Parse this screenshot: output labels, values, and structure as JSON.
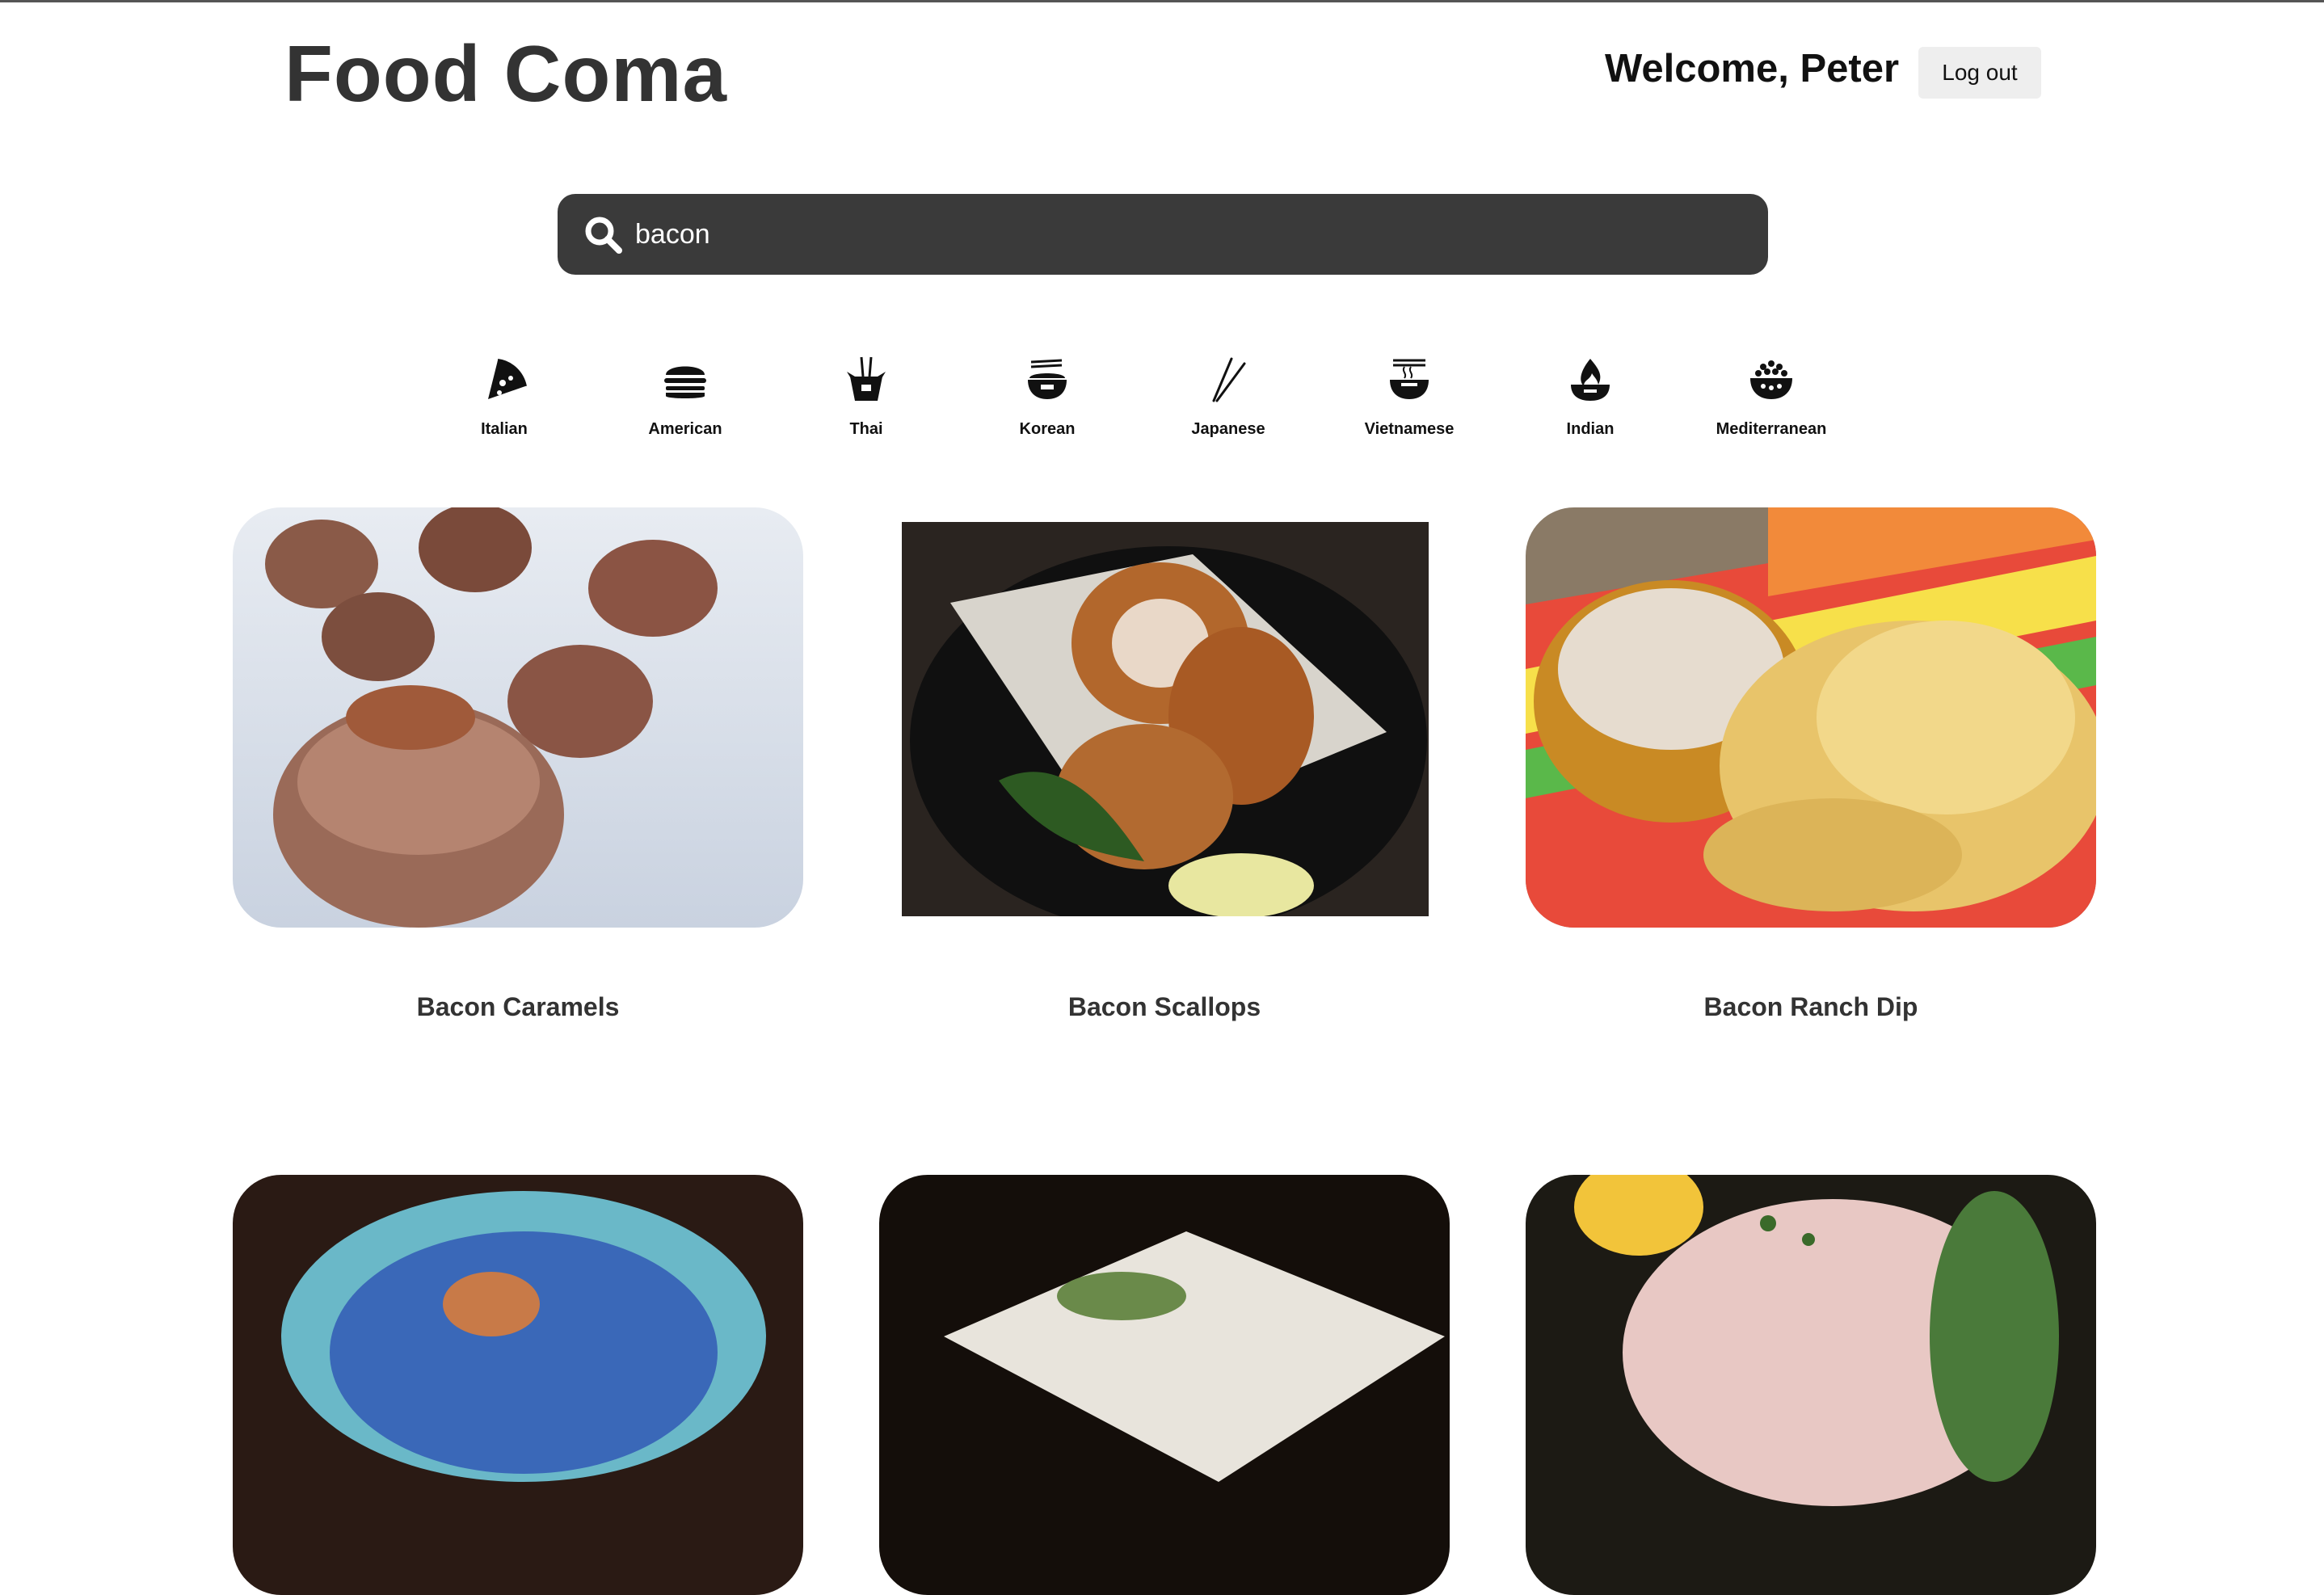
{
  "header": {
    "app_title": "Food Coma",
    "welcome": "Welcome, Peter",
    "logout_label": "Log out"
  },
  "search": {
    "value": "bacon",
    "icon": "search-icon"
  },
  "categories": [
    {
      "label": "Italian",
      "icon": "pizza-icon"
    },
    {
      "label": "American",
      "icon": "burger-icon"
    },
    {
      "label": "Thai",
      "icon": "takeout-box-icon"
    },
    {
      "label": "Korean",
      "icon": "rice-bowl-icon"
    },
    {
      "label": "Japanese",
      "icon": "chopsticks-icon"
    },
    {
      "label": "Vietnamese",
      "icon": "noodle-bowl-icon"
    },
    {
      "label": "Indian",
      "icon": "fire-pot-icon"
    },
    {
      "label": "Mediterranean",
      "icon": "grain-bowl-icon"
    }
  ],
  "recipes": [
    {
      "title": "Bacon Caramels"
    },
    {
      "title": "Bacon Scallops"
    },
    {
      "title": "Bacon Ranch Dip"
    },
    {
      "title": ""
    },
    {
      "title": ""
    },
    {
      "title": ""
    }
  ],
  "colors": {
    "search_bg": "#3a3a3a",
    "button_bg": "#eeeeee",
    "text_dark": "#333333"
  }
}
